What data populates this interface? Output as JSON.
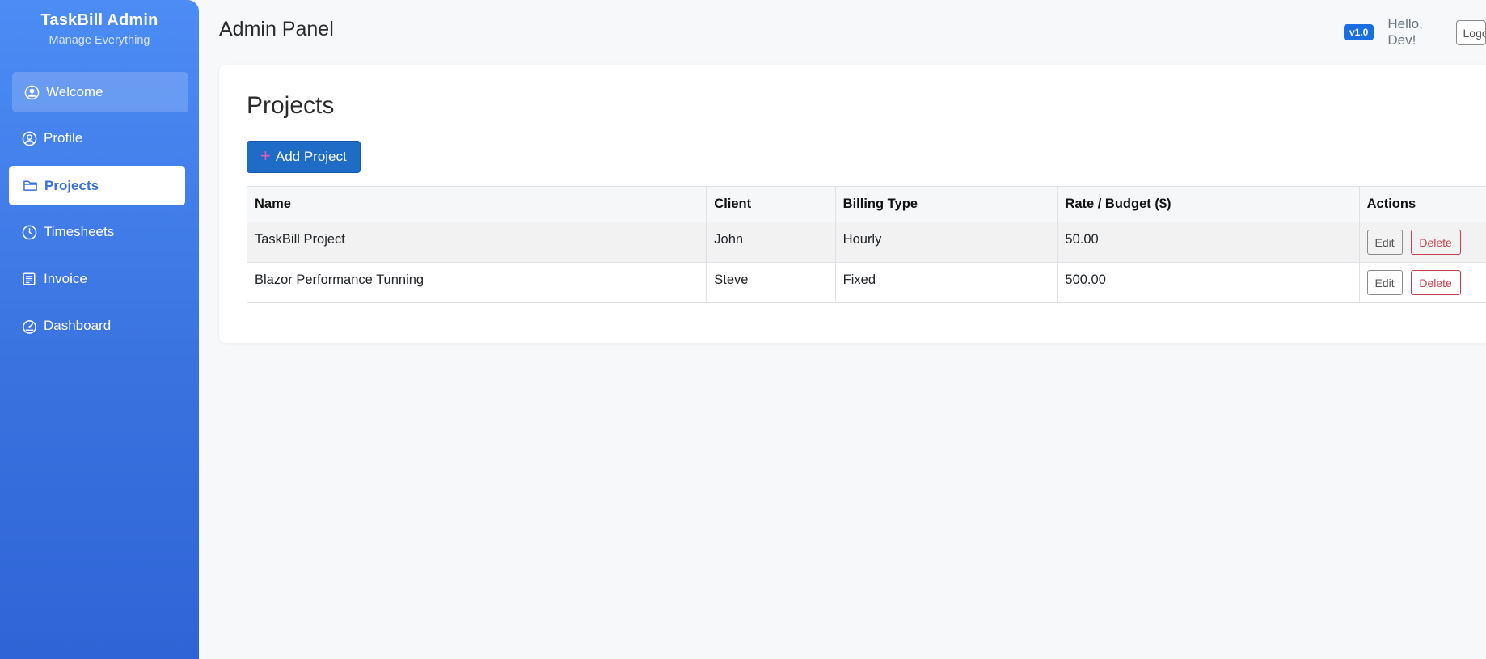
{
  "sidebar": {
    "brand_title": "TaskBill Admin",
    "brand_subtitle": "Manage Everything",
    "items": [
      {
        "label": "Welcome",
        "icon": "user-circle-icon"
      },
      {
        "label": "Profile",
        "icon": "user-circle-icon"
      },
      {
        "label": "Projects",
        "icon": "folder-icon",
        "active": true
      },
      {
        "label": "Timesheets",
        "icon": "clock-icon"
      },
      {
        "label": "Invoice",
        "icon": "invoice-icon"
      },
      {
        "label": "Dashboard",
        "icon": "speedometer-icon"
      }
    ]
  },
  "header": {
    "title": "Admin Panel",
    "version_badge": "v1.0",
    "greeting": "Hello, Dev!",
    "logout_label": "Logout"
  },
  "projects": {
    "title": "Projects",
    "add_button_label": "Add Project",
    "columns": [
      "Name",
      "Client",
      "Billing Type",
      "Rate / Budget ($)",
      "Actions"
    ],
    "rows": [
      {
        "name": "TaskBill Project",
        "client": "John",
        "billing_type": "Hourly",
        "rate": "50.00"
      },
      {
        "name": "Blazor Performance Tunning",
        "client": "Steve",
        "billing_type": "Fixed",
        "rate": "500.00"
      }
    ],
    "edit_label": "Edit",
    "delete_label": "Delete"
  },
  "colors": {
    "sidebar_gradient_top": "#4c8cf5",
    "sidebar_gradient_bottom": "#2f64d6",
    "primary_button": "#1e6cc6",
    "badge": "#1a6fe0",
    "danger": "#c8414e"
  }
}
